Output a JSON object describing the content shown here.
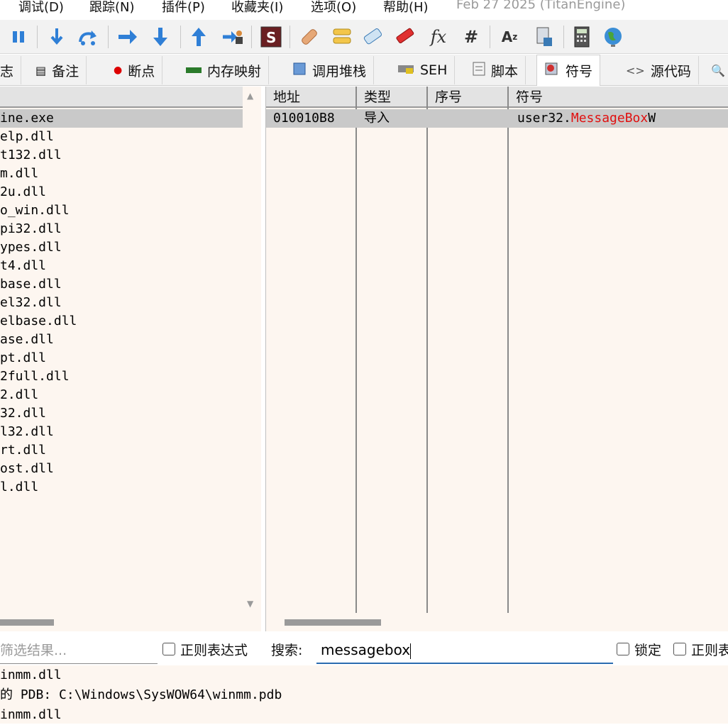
{
  "menu": {
    "items": [
      "调试(D)",
      "跟踪(N)",
      "插件(P)",
      "收藏夹(I)",
      "选项(O)",
      "帮助(H)"
    ],
    "version": "Feb 27 2025 (TitanEngine)"
  },
  "toolbar": {
    "buttons": [
      "pause-icon",
      "step-into-icon",
      "step-over-icon",
      "step-out-icon",
      "run-to-user-code-icon",
      "execute-till-return-icon",
      "animate-icon",
      "scylla-icon",
      "patch-icon",
      "comment-icon",
      "label-icon",
      "bookmark-icon",
      "function-icon",
      "hash-icon",
      "strings-icon",
      "calculator-doc-icon",
      "calculator-icon",
      "globe-icon"
    ]
  },
  "tabs": [
    {
      "label": "志",
      "icon": "log-icon"
    },
    {
      "label": "备注",
      "icon": "notes-icon"
    },
    {
      "label": "断点",
      "icon": "breakpoint-icon"
    },
    {
      "label": "内存映射",
      "icon": "memory-map-icon"
    },
    {
      "label": "调用堆栈",
      "icon": "call-stack-icon"
    },
    {
      "label": "SEH",
      "icon": "seh-icon"
    },
    {
      "label": "脚本",
      "icon": "script-icon"
    },
    {
      "label": "符号",
      "icon": "symbols-icon"
    },
    {
      "label": "源代码",
      "icon": "source-icon"
    }
  ],
  "modules": [
    "ine.exe",
    "elp.dll",
    "t132.dll",
    "m.dll",
    "2u.dll",
    "o_win.dll",
    "pi32.dll",
    "ypes.dll",
    "t4.dll",
    "base.dll",
    "el32.dll",
    "elbase.dll",
    "ase.dll",
    "pt.dll",
    "2full.dll",
    "2.dll",
    "32.dll",
    "l32.dll",
    "rt.dll",
    "ost.dll",
    "l.dll"
  ],
  "symbols": {
    "headers": {
      "address": "地址",
      "type": "类型",
      "ordinal": "序号",
      "symbol": "符号"
    },
    "rows": [
      {
        "address": "010010B8",
        "type": "导入",
        "ordinal": "",
        "symbol_prefix": "user32.",
        "symbol_match": "MessageBox",
        "symbol_suffix": "W"
      }
    ]
  },
  "search": {
    "filter_placeholder": "筛选结果...",
    "regex_label": "正则表达式",
    "search_label": "搜索:",
    "search_value": "messagebox",
    "lock_label": "锁定",
    "regex2_label": "正则表"
  },
  "log": {
    "lines": [
      "inmm.dll",
      "的 PDB: C:\\Windows\\SysWOW64\\winmm.pdb",
      "inmm.dll"
    ]
  },
  "colors": {
    "highlight": "#e01010",
    "pane_bg": "#fdf6f0",
    "selected_row": "#c9c9c9"
  }
}
